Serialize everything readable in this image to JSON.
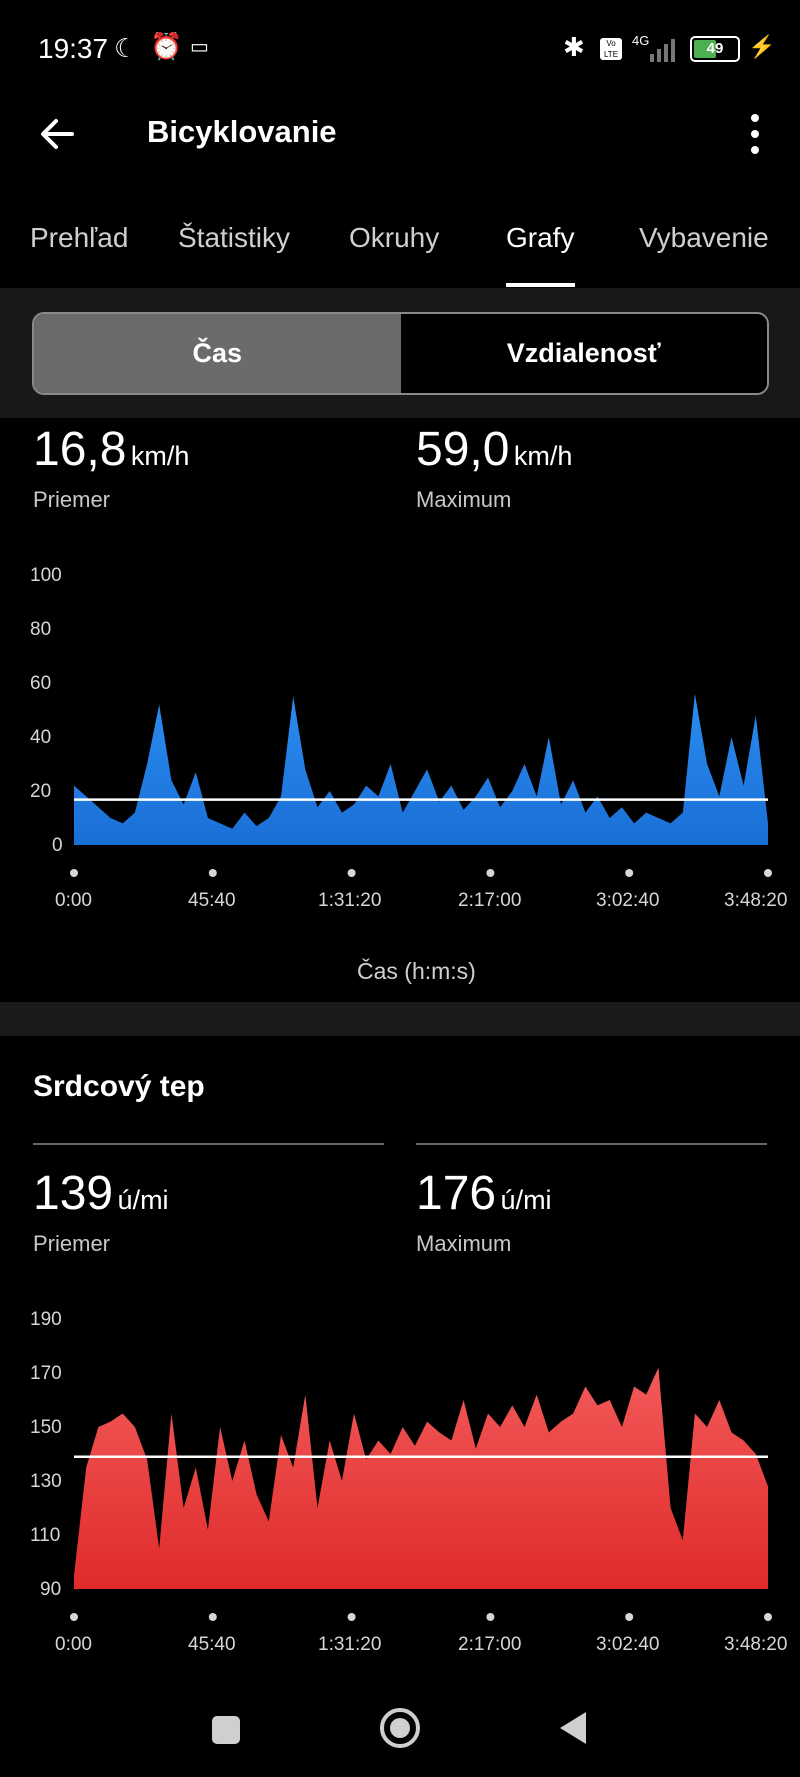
{
  "status_bar": {
    "time": "19:37",
    "battery": "49",
    "network": "4G"
  },
  "header": {
    "title": "Bicyklovanie"
  },
  "tabs": [
    {
      "label": "Prehľad",
      "active": false
    },
    {
      "label": "Štatistiky",
      "active": false
    },
    {
      "label": "Okruhy",
      "active": false
    },
    {
      "label": "Grafy",
      "active": true
    },
    {
      "label": "Vybavenie",
      "active": false
    }
  ],
  "segment": {
    "time_label": "Čas",
    "distance_label": "Vzdialenosť",
    "selected": "Čas"
  },
  "speed": {
    "avg_value": "16,8",
    "avg_unit": "km/h",
    "avg_label": "Priemer",
    "max_value": "59,0",
    "max_unit": "km/h",
    "max_label": "Maximum"
  },
  "heart_rate": {
    "title": "Srdcový tep",
    "avg_value": "139",
    "avg_unit": "ú/mi",
    "avg_label": "Priemer",
    "max_value": "176",
    "max_unit": "ú/mi",
    "max_label": "Maximum"
  },
  "colors": {
    "speed_series": "#1f7ae0",
    "hr_series": "#e83a3a",
    "average_line": "#ffffff"
  },
  "chart_data": [
    {
      "type": "area",
      "title": "",
      "xlabel": "Čas (h:m:s)",
      "ylabel": "",
      "ylim": [
        0,
        100
      ],
      "y_ticks": [
        "0",
        "20",
        "40",
        "60",
        "80",
        "100"
      ],
      "x_ticks": [
        "0:00",
        "45:40",
        "1:31:20",
        "2:17:00",
        "3:02:40",
        "3:48:20"
      ],
      "average": 16.8,
      "series": [
        {
          "x_minutes": [
            0,
            4,
            8,
            12,
            16,
            20,
            24,
            28,
            32,
            36,
            40,
            44,
            48,
            52,
            56,
            60,
            64,
            68,
            72,
            76,
            80,
            84,
            88,
            92,
            96,
            100,
            104,
            108,
            112,
            116,
            120,
            124,
            128,
            132,
            136,
            140,
            144,
            148,
            152,
            156,
            160,
            164,
            168,
            172,
            176,
            180,
            184,
            188,
            192,
            196,
            200,
            204,
            208,
            212,
            216,
            220,
            224,
            228
          ],
          "values": [
            22,
            18,
            14,
            10,
            8,
            12,
            30,
            52,
            24,
            15,
            27,
            10,
            8,
            6,
            12,
            7,
            10,
            18,
            55,
            28,
            14,
            20,
            12,
            15,
            22,
            18,
            30,
            12,
            20,
            28,
            16,
            22,
            13,
            18,
            25,
            14,
            20,
            30,
            18,
            40,
            15,
            24,
            12,
            18,
            10,
            14,
            8,
            12,
            10,
            8,
            12,
            56,
            30,
            18,
            40,
            22,
            48,
            8
          ]
        }
      ]
    },
    {
      "type": "area",
      "title": "",
      "xlabel": "",
      "ylabel": "",
      "ylim": [
        90,
        190
      ],
      "y_ticks": [
        "90",
        "110",
        "130",
        "150",
        "170",
        "190"
      ],
      "x_ticks": [
        "0:00",
        "45:40",
        "1:31:20",
        "2:17:00",
        "3:02:40",
        "3:48:20"
      ],
      "average": 139,
      "series": [
        {
          "x_minutes": [
            0,
            4,
            8,
            12,
            16,
            20,
            24,
            28,
            32,
            36,
            40,
            44,
            48,
            52,
            56,
            60,
            64,
            68,
            72,
            76,
            80,
            84,
            88,
            92,
            96,
            100,
            104,
            108,
            112,
            116,
            120,
            124,
            128,
            132,
            136,
            140,
            144,
            148,
            152,
            156,
            160,
            164,
            168,
            172,
            176,
            180,
            184,
            188,
            192,
            196,
            200,
            204,
            208,
            212,
            216,
            220,
            224,
            228
          ],
          "values": [
            95,
            135,
            150,
            152,
            155,
            150,
            138,
            105,
            155,
            120,
            135,
            112,
            150,
            130,
            145,
            125,
            115,
            147,
            135,
            162,
            120,
            145,
            130,
            155,
            138,
            145,
            140,
            150,
            143,
            152,
            148,
            145,
            160,
            142,
            155,
            150,
            158,
            150,
            162,
            148,
            152,
            155,
            165,
            158,
            160,
            150,
            165,
            162,
            172,
            120,
            108,
            155,
            150,
            160,
            148,
            145,
            140,
            128
          ]
        }
      ]
    }
  ]
}
